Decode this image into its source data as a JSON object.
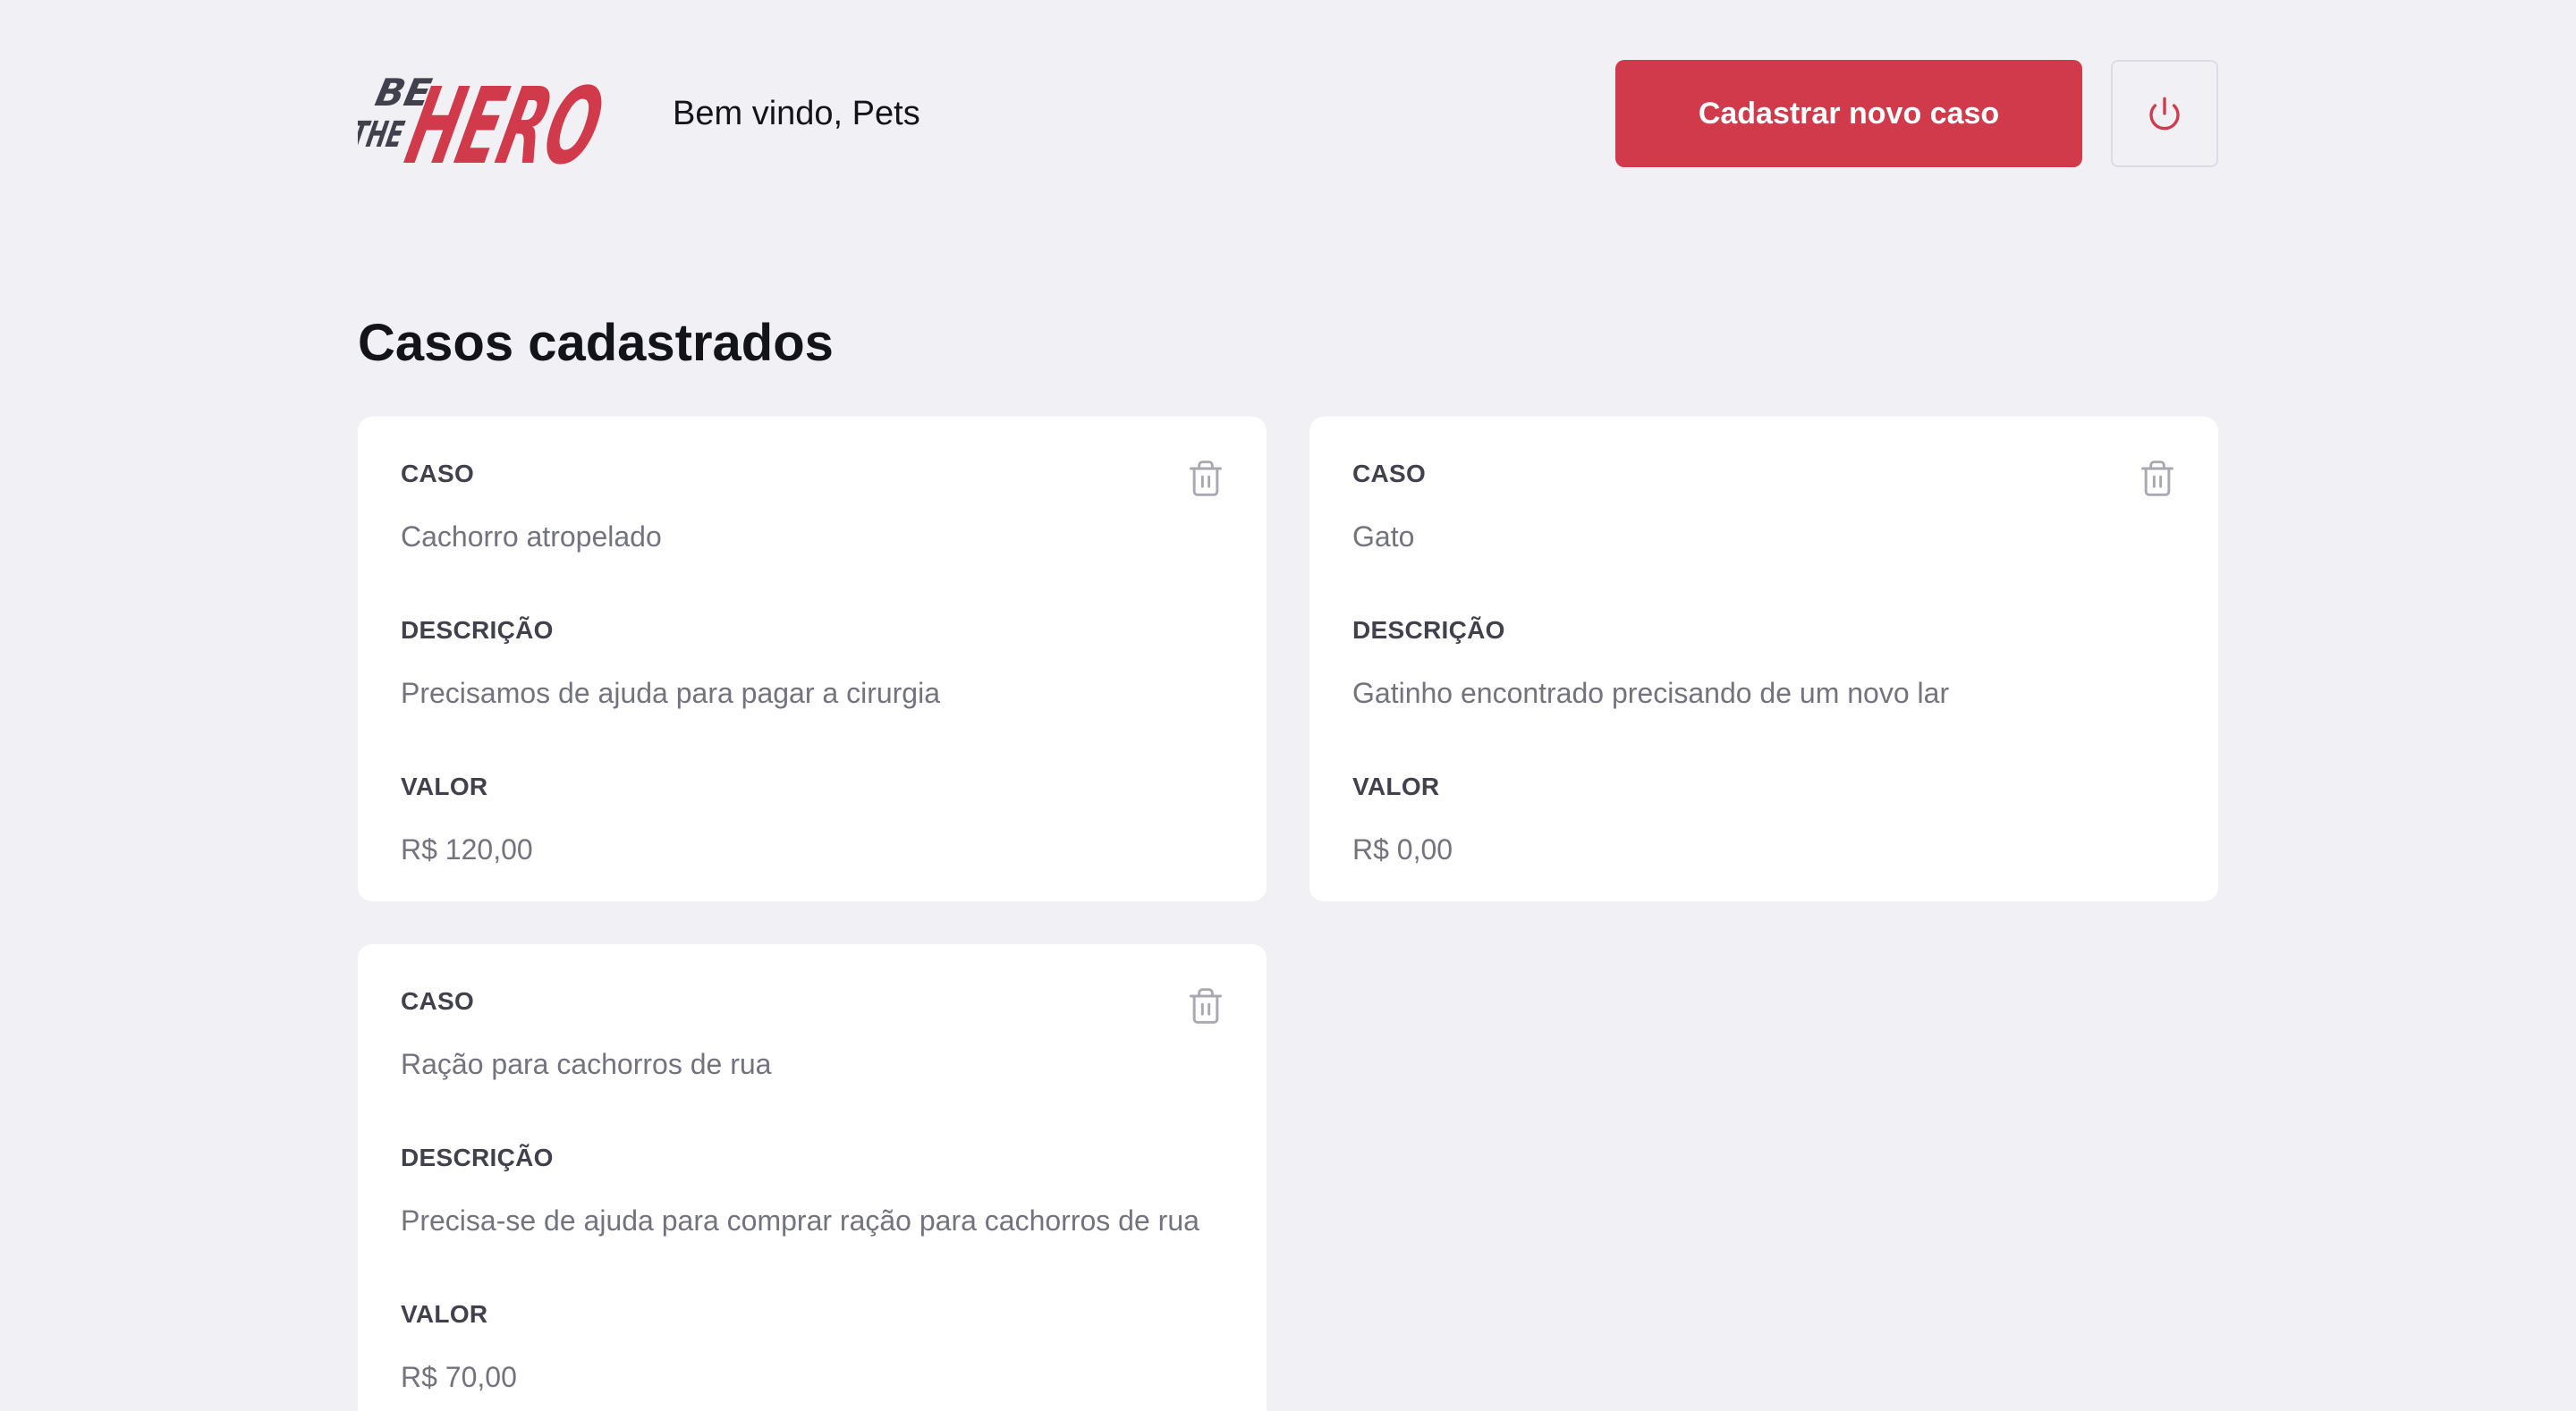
{
  "header": {
    "logo_text": "BE THE HERO",
    "welcome": "Bem vindo, Pets",
    "new_case_button": "Cadastrar novo caso",
    "logout_icon": "power-icon"
  },
  "title": "Casos cadastrados",
  "labels": {
    "case": "CASO",
    "description": "DESCRIÇÃO",
    "value": "VALOR"
  },
  "cases": [
    {
      "title": "Cachorro atropelado",
      "description": "Precisamos de ajuda para pagar a cirurgia",
      "value": "R$ 120,00"
    },
    {
      "title": "Gato",
      "description": "Gatinho encontrado precisando de um novo lar",
      "value": "R$ 0,00"
    },
    {
      "title": "Ração para cachorros de rua",
      "description": "Precisa-se de ajuda para comprar ração para cachorros de rua",
      "value": "R$ 70,00"
    }
  ],
  "colors": {
    "accent": "#d13a4a",
    "background": "#f0f0f5",
    "card": "#ffffff",
    "label": "#41414d",
    "text": "#737380",
    "logo_dark": "#41414d"
  }
}
